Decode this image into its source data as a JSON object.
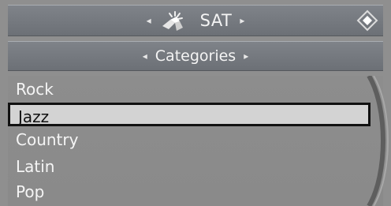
{
  "source": {
    "title": "SAT",
    "prev_arrow": "◂",
    "next_arrow": "▸"
  },
  "category_bar": {
    "title": "Categories",
    "prev_arrow": "◂",
    "next_arrow": "▸"
  },
  "categories": [
    {
      "label": "Rock",
      "selected": false
    },
    {
      "label": "Jazz",
      "selected": true
    },
    {
      "label": "Country",
      "selected": false
    },
    {
      "label": "Latin",
      "selected": false
    },
    {
      "label": "Pop",
      "selected": false
    }
  ],
  "icons": {
    "source": "satellite-icon",
    "home": "home-icon"
  }
}
